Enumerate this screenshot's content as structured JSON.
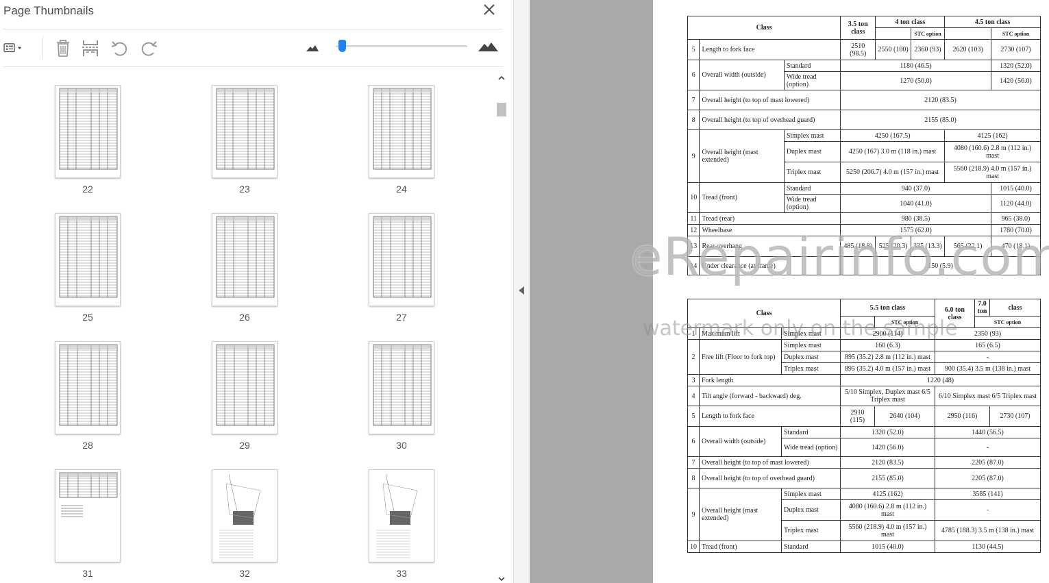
{
  "panel": {
    "title": "Page Thumbnails",
    "close_glyph": "✕",
    "toolbar": [
      {
        "name": "options-menu-icon",
        "glyph": "list-dropdown"
      },
      {
        "name": "delete-icon",
        "glyph": "trash"
      },
      {
        "name": "extract-icon",
        "glyph": "extract"
      },
      {
        "name": "rotate-left-icon",
        "glyph": "rotate-ccw"
      },
      {
        "name": "rotate-right-icon",
        "glyph": "rotate-cw"
      },
      {
        "name": "zoom-out-mountain-icon",
        "glyph": "small-mountain"
      },
      {
        "name": "zoom-in-mountain-icon",
        "glyph": "large-mountain"
      }
    ],
    "zoom_slider_fraction": 0.04,
    "thumbnails": [
      {
        "page": "22"
      },
      {
        "page": "23"
      },
      {
        "page": "24"
      },
      {
        "page": "25"
      },
      {
        "page": "26"
      },
      {
        "page": "27"
      },
      {
        "page": "28"
      },
      {
        "page": "29"
      },
      {
        "page": "30"
      },
      {
        "page": "31"
      },
      {
        "page": "32"
      },
      {
        "page": "33"
      }
    ]
  },
  "colors": {
    "accent": "#2680eb",
    "gray_area": "#a9a9a9"
  },
  "watermark": {
    "main": "eRepairinfo.com",
    "sub": "watermark only on the sample"
  },
  "table1": {
    "header": {
      "class": "Class",
      "c35": "3.5 ton class",
      "c4": "4 ton  class",
      "c45": "4.5  ton class",
      "stc1": "STC option",
      "stc2": "STC option"
    },
    "rows": {
      "r5": {
        "n": "5",
        "label": "Length to fork face",
        "v": [
          "2510 (98.5)",
          "2550 (100)",
          "2360 (93)",
          "2620 (103)",
          "2730 (107)"
        ]
      },
      "r6": {
        "n": "6",
        "label": "Overall width (outside)",
        "sub1": "Standard",
        "v1a": "1180 (46.5)",
        "v1b": "1320 (52.0)",
        "sub2": "Wide tread (option)",
        "v2a": "1270 (50.0)",
        "v2b": "1420 (56.0)"
      },
      "r7": {
        "n": "7",
        "label": "Overall height (to top of mast lowered)",
        "v": "2120 (83.5)"
      },
      "r8": {
        "n": "8",
        "label": "Overall height (to top of overhead guard)",
        "v": "2155 (85.0)"
      },
      "r9": {
        "n": "9",
        "label": "Overall height (mast extended)",
        "s1": "Simplex mast",
        "s1a": "4250 (167.5)",
        "s1b": "4125 (162)",
        "s2": "Duplex mast",
        "s2a": "4250 (167) 3.0 m (118 in.) mast",
        "s2b": "4080 (160.6) 2.8 m (112 in.) mast",
        "s3": "Triplex mast",
        "s3a": "5250 (206.7) 4.0 m (157 in.) mast",
        "s3b": "5560 (218.9) 4.0 m (157 in.) mast"
      },
      "r10": {
        "n": "10",
        "label": "Tread (front)",
        "sub1": "Standard",
        "v1a": "940 (37.0)",
        "v1b": "1015 (40.0)",
        "sub2": "Wide tread (option)",
        "v2a": "1040 (41.0)",
        "v2b": "1120 (44.0)"
      },
      "r11": {
        "n": "11",
        "label": "Tread (rear)",
        "va": "980 (38.5)",
        "vb": "965 (38.0)"
      },
      "r12": {
        "n": "12",
        "label": "Wheelbase",
        "va": "1575 (62.0)",
        "vb": "1780 (70.0)"
      },
      "r13": {
        "n": "13",
        "label": "Rear overhang",
        "v": [
          "485 (18.8)",
          "525 (20.3)",
          "335 (13.3)",
          "565 (22.1)",
          "470 (18.1)"
        ]
      },
      "r14": {
        "n": "14",
        "label": "Under clearance (at frame)",
        "v": "150 (5.9)"
      }
    }
  },
  "table2": {
    "header": {
      "class": "Class",
      "c55": "5.5 ton  class",
      "c60": "6.0 ton class",
      "c70a": "7.0 ton",
      "c70b": "class",
      "stc1": "STC option",
      "stc2": "STC option"
    },
    "rows": {
      "r1": {
        "n": "1",
        "label": "Maximum lift",
        "sub": "Simplex mast",
        "va": "2900 (114)",
        "vb": "2350 (93)"
      },
      "r2": {
        "n": "2",
        "label": "Free lift (Floor to fork top)",
        "s1": "Simplex mast",
        "s1a": "160 (6.3)",
        "s1b": "165 (6.5)",
        "s2": "Duplex mast",
        "s2a": "895 (35.2) 2.8 m (112 in.) mast",
        "s2b": "-",
        "s3": "Triplex mast",
        "s3a": "895 (35.2) 4.0 m (157 in.) mast",
        "s3b": "900 (35.4) 3.5 m (138 in.) mast"
      },
      "r3": {
        "n": "3",
        "label": "Fork length",
        "v": "1220 (48)"
      },
      "r4": {
        "n": "4",
        "label": "Tilt angle (forward - backward) deg.",
        "va": "5/10 Simplex, Duplex mast 6/5 Triplex mast",
        "vb": "6/10 Simplex mast 6/5 Triplex mast"
      },
      "r5": {
        "n": "5",
        "label": "Length to fork face",
        "v": [
          "2910 (115)",
          "2640 (104)",
          "2950 (116)",
          "2730 (107)"
        ]
      },
      "r6": {
        "n": "6",
        "label": "Overall width (outside)",
        "sub1": "Standard",
        "v1a": "1320 (52.0)",
        "v1b": "1440 (56.5)",
        "sub2": "Wide tread (option)",
        "v2a": "1420 (56.0)",
        "v2b": "-"
      },
      "r7": {
        "n": "7",
        "label": "Overall height (to top of mast lowered)",
        "va": "2120 (83.5)",
        "vb": "2205 (87.0)"
      },
      "r8": {
        "n": "8",
        "label": "Overall height (to top of overhead guard)",
        "va": "2155 (85.0)",
        "vb": "2205 (87.0)"
      },
      "r9": {
        "n": "9",
        "label": "Overall height (mast extended)",
        "s1": "Simplex mast",
        "s1a": "4125 (162)",
        "s1b": "3585 (141)",
        "s2": "Duplex mast",
        "s2a": "4080 (160.6) 2.8 m (112 in.) mast",
        "s2b": "-",
        "s3": "Triplex mast",
        "s3a": "5560 (218.9) 4.0 m (157 in.) mast",
        "s3b": "4785 (188.3) 3.5 m (138 in.) mast"
      },
      "r10": {
        "n": "10",
        "label": "Tread (front)",
        "sub1": "Standard",
        "v1a": "1015 (40.0)",
        "v1b": "1130 (44.5)"
      }
    }
  }
}
